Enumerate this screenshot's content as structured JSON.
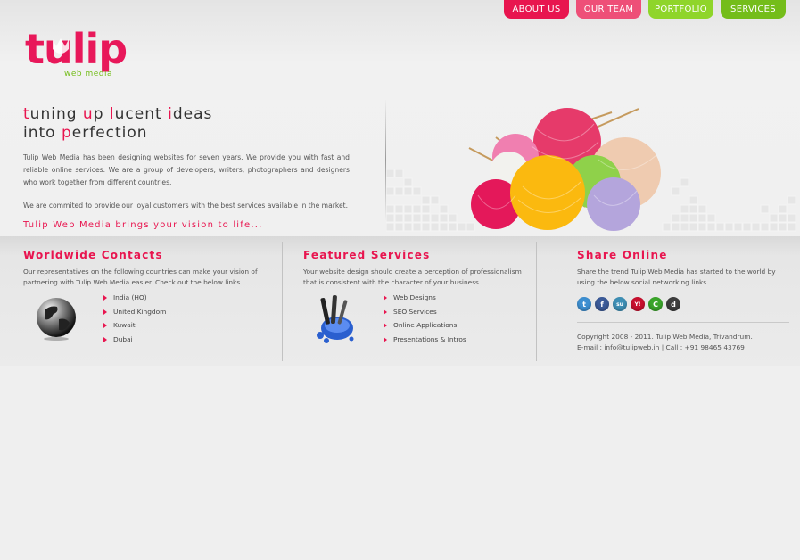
{
  "nav": {
    "about": "ABOUT US",
    "team": "OUR TEAM",
    "portfolio": "PORTFOLIO",
    "services": "SERVICES"
  },
  "logo": {
    "word": "tulip",
    "sub": "web media"
  },
  "hero": {
    "tagline_line1_parts": [
      "t",
      "uning ",
      "u",
      "p ",
      "l",
      "ucent ",
      "i",
      "deas"
    ],
    "tagline_line2_parts": [
      "into ",
      "p",
      "erfection"
    ],
    "intro": "Tulip Web Media has been designing websites for seven years. We provide you with fast and reliable online services. We are a group of developers, writers, photographers and designers who work together from different countries.",
    "intro2": "We are commited to provide our loyal customers with the best services available in the market.",
    "slogan": "Tulip Web Media brings your vision to life..."
  },
  "contacts": {
    "title": "Worldwide Contacts",
    "text": "Our representatives on the following countries can make your vision of partnering with Tulip Web Media easier. Check out the below links.",
    "items": [
      "India (HO)",
      "United Kingdom",
      "Kuwait",
      "Dubai"
    ]
  },
  "services": {
    "title": "Featured Services",
    "text": "Your website design should create a perception of professionalism that is consistent with the character of your business.",
    "items": [
      "Web Designs",
      "SEO Services",
      "Online Applications",
      "Presentations & Intros"
    ]
  },
  "share": {
    "title": "Share Online",
    "text": "Share the trend Tulip Web Media has started to the world by using the below social networking links.",
    "icons": [
      {
        "name": "twitter-icon",
        "glyph": "t",
        "color": "#3d8fd1"
      },
      {
        "name": "facebook-icon",
        "glyph": "f",
        "color": "#3b5a98"
      },
      {
        "name": "stumbleupon-icon",
        "glyph": "su",
        "color": "#3e8fb5"
      },
      {
        "name": "yahoo-icon",
        "glyph": "Y!",
        "color": "#c8102e"
      },
      {
        "name": "green-share-icon",
        "glyph": "C",
        "color": "#3aa52a"
      },
      {
        "name": "delicious-icon",
        "glyph": "d",
        "color": "#3d3d3d"
      }
    ],
    "copyright": "Copyright 2008 - 2011. Tulip Web Media, Trivandrum.",
    "contact": "E-mail : info@tulipweb.in | Call : +91 98465 43769"
  },
  "colors": {
    "accent": "#e8154f",
    "green": "#74bd1a"
  }
}
